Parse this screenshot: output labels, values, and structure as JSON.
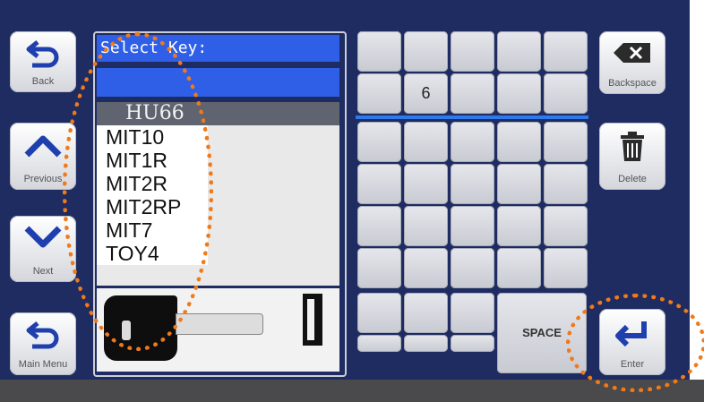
{
  "left_buttons": {
    "back": "Back",
    "previous": "Previous",
    "next": "Next",
    "main_menu": "Main Menu"
  },
  "right_buttons": {
    "backspace": "Backspace",
    "delete": "Delete",
    "enter": "Enter"
  },
  "panel": {
    "title": "Select Key:",
    "input_value": "",
    "selected_key": "HU66",
    "keys": [
      "MIT10",
      "MIT1R",
      "MIT2R",
      "MIT2RP",
      "MIT7",
      "TOY4"
    ]
  },
  "keypad": {
    "entered_char": "6",
    "space_label": "SPACE"
  },
  "colors": {
    "screen_bg": "#1e2c62",
    "accent_blue": "#2f5fe6",
    "highlight_orange": "#f07a1a"
  },
  "icons": [
    "back-arrow-icon",
    "chevron-up-icon",
    "chevron-down-icon",
    "return-arrow-icon",
    "backspace-icon",
    "trash-icon",
    "enter-arrow-icon"
  ]
}
